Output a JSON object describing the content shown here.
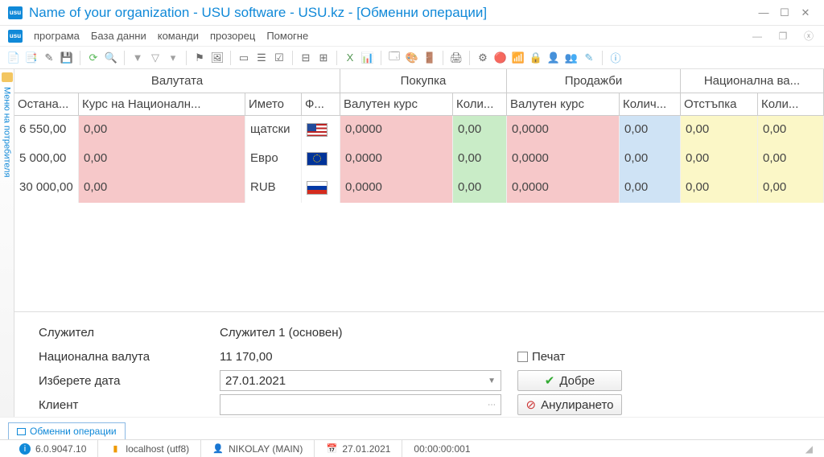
{
  "window": {
    "title": "Name of your organization - USU software - USU.kz - [Обменни операции]"
  },
  "menu": {
    "items": [
      "програма",
      "База данни",
      "команди",
      "прозорец",
      "Помогне"
    ]
  },
  "sidetab": {
    "label": "Меню на потребителя"
  },
  "grid": {
    "groups": [
      "Валутата",
      "Покупка",
      "Продажби",
      "Национална ва..."
    ],
    "cols": [
      "Остана...",
      "Курс на Националн...",
      "Името",
      "Ф...",
      "Валутен курс",
      "Коли...",
      "Валутен курс",
      "Колич...",
      "Отстъпка",
      "Коли..."
    ],
    "rows": [
      {
        "c0": "6 550,00",
        "c1": "0,00",
        "c2": "щатски",
        "flag": "us",
        "c4": "0,0000",
        "c5": "0,00",
        "c6": "0,0000",
        "c7": "0,00",
        "c8": "0,00",
        "c9": "0,00"
      },
      {
        "c0": "5 000,00",
        "c1": "0,00",
        "c2": "Евро",
        "flag": "eu",
        "c4": "0,0000",
        "c5": "0,00",
        "c6": "0,0000",
        "c7": "0,00",
        "c8": "0,00",
        "c9": "0,00"
      },
      {
        "c0": "30 000,00",
        "c1": "0,00",
        "c2": "RUB",
        "flag": "ru",
        "c4": "0,0000",
        "c5": "0,00",
        "c6": "0,0000",
        "c7": "0,00",
        "c8": "0,00",
        "c9": "0,00"
      }
    ]
  },
  "form": {
    "employee_label": "Служител",
    "employee_value": "Служител 1 (основен)",
    "natcur_label": "Национална валута",
    "natcur_value": "11 170,00",
    "date_label": "Изберете дата",
    "date_value": "27.01.2021",
    "client_label": "Клиент",
    "client_value": "",
    "print_label": "Печат",
    "ok_label": "Добре",
    "cancel_label": "Анулирането"
  },
  "tab": {
    "label": "Обменни операции"
  },
  "status": {
    "version": "6.0.9047.10",
    "host": "localhost (utf8)",
    "user": "NIKOLAY (MAIN)",
    "date": "27.01.2021",
    "time": "00:00:00:001"
  }
}
